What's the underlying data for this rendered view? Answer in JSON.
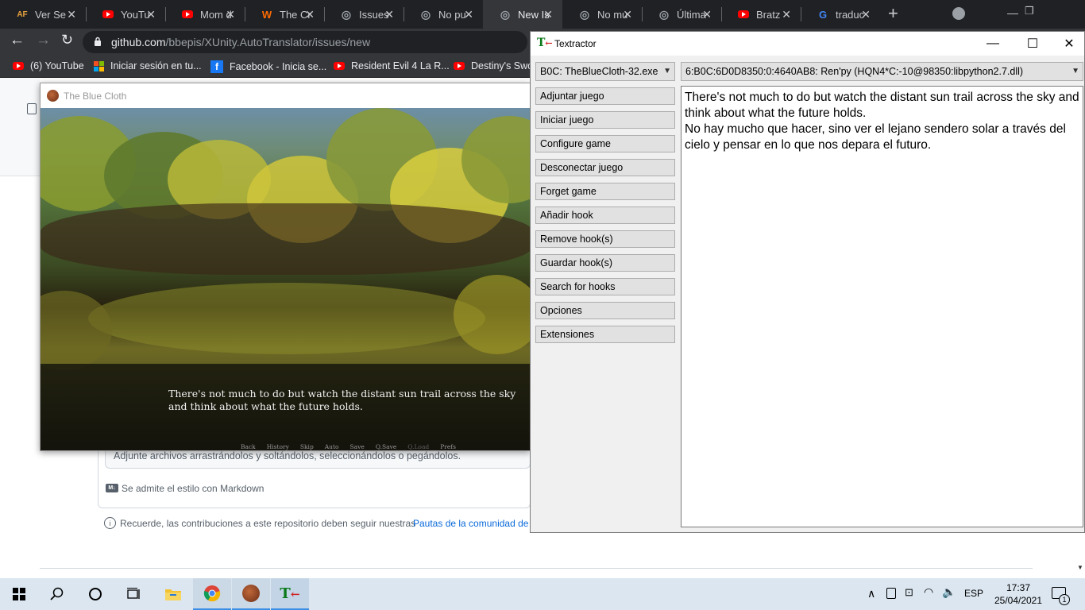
{
  "browser": {
    "tabs": [
      {
        "title": "Ver Se",
        "favicon": "af-icon",
        "color": "#e8a33d",
        "glyph": "AF"
      },
      {
        "title": "YouTu",
        "favicon": "youtube-icon",
        "color": "#ff0000",
        "glyph": "▶"
      },
      {
        "title": "Mom d",
        "favicon": "youtube-icon",
        "color": "#ff0000",
        "glyph": "▶"
      },
      {
        "title": "The Cr",
        "favicon": "w-icon",
        "color": "#ff6a00",
        "glyph": "W"
      },
      {
        "title": "Issues",
        "favicon": "github-icon",
        "color": "#9aa0a6",
        "glyph": "◎"
      },
      {
        "title": "No pu",
        "favicon": "github-icon",
        "color": "#9aa0a6",
        "glyph": "◎"
      },
      {
        "title": "New Is",
        "favicon": "github-icon",
        "color": "#9aa0a6",
        "glyph": "◎"
      },
      {
        "title": "No mu",
        "favicon": "github-icon",
        "color": "#9aa0a6",
        "glyph": "◎"
      },
      {
        "title": "Última",
        "favicon": "github-icon",
        "color": "#9aa0a6",
        "glyph": "◎"
      },
      {
        "title": "Bratz",
        "favicon": "youtube-icon",
        "color": "#ff0000",
        "glyph": "▶"
      },
      {
        "title": "traduc",
        "favicon": "google-icon",
        "color": "#4285f4",
        "glyph": "G"
      }
    ],
    "address_host": "github.com",
    "address_path": "/bbepis/XUnity.AutoTranslator/issues/new",
    "bookmarks": {
      "b1": "(6) YouTube",
      "b2": "Iniciar sesión en tu...",
      "b3": "Facebook - Inicia se...",
      "b4": "Resident Evil 4 La R...",
      "b5": "Destiny's Swo"
    }
  },
  "github": {
    "attach_hint": "Adjunte archivos arrastrándolos y soltándolos, seleccionándolos o pegándolos.",
    "markdown_note": "Se admite el estilo con Markdown",
    "contrib_note": "Recuerde, las contribuciones a este repositorio deben seguir nuestras",
    "contrib_link": "Pautas de la comunidad de"
  },
  "game": {
    "window_title": "The Blue Cloth",
    "dialog_line1": "There's not much to do but watch the distant sun trail across the sky",
    "dialog_line2": "and think about what the future holds.",
    "menu": [
      "Back",
      "History",
      "Skip",
      "Auto",
      "Save",
      "Q.Save",
      "Q.Load",
      "Prefs"
    ]
  },
  "textractor": {
    "title": "Textractor",
    "process": "B0C: TheBlueCloth-32.exe",
    "hook": "6:B0C:6D0D8350:0:4640AB8: Ren'py (HQN4*C:-10@98350:libpython2.7.dll)",
    "buttons": {
      "attach": "Adjuntar juego",
      "launch": "Iniciar juego",
      "configure": "Configure game",
      "detach": "Desconectar juego",
      "forget": "Forget game",
      "add_hook": "Añadir hook",
      "remove_hook": "Remove hook(s)",
      "save_hook": "Guardar hook(s)",
      "search_hooks": "Search for hooks",
      "options": "Opciones",
      "extensions": "Extensiones"
    },
    "text_en": "There's not much to do but watch the distant sun trail across the sky and think about what the future holds.",
    "text_es": "No hay mucho que hacer, sino ver el lejano sendero solar a través del cielo y pensar en lo que nos depara el futuro."
  },
  "taskbar": {
    "language": "ESP",
    "time": "17:37",
    "date": "25/04/2021",
    "notification_count": "1"
  }
}
